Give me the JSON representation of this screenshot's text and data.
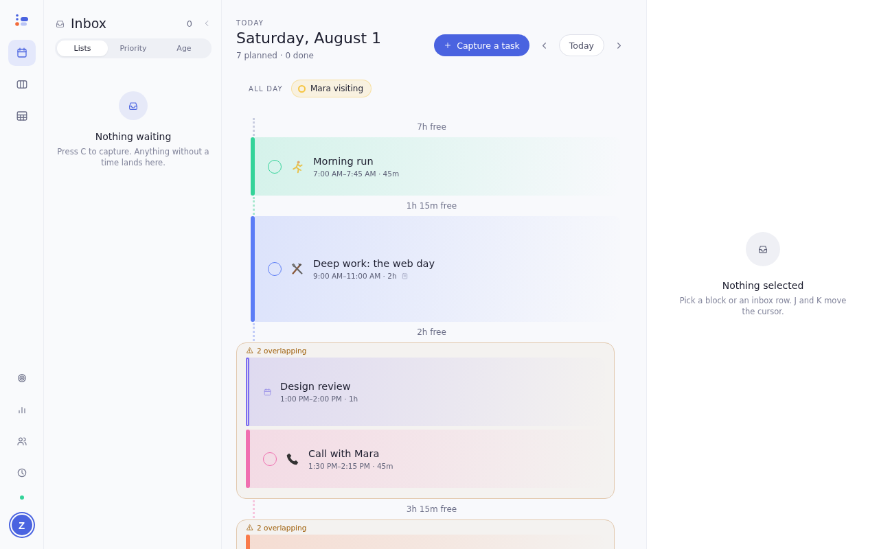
{
  "rail": {
    "top": [
      {
        "kind": "calendar",
        "selected": true
      },
      {
        "kind": "columns",
        "selected": false
      },
      {
        "kind": "table",
        "selected": false
      }
    ],
    "bottom": [
      {
        "kind": "target",
        "selected": false
      },
      {
        "kind": "chart",
        "selected": false
      },
      {
        "kind": "people",
        "selected": false
      },
      {
        "kind": "clock",
        "selected": false
      }
    ],
    "status": {
      "online": true
    },
    "avatar": "Z"
  },
  "inbox": {
    "title": "Inbox",
    "count": "0",
    "tabs": [
      {
        "label": "Lists",
        "selected": true
      },
      {
        "label": "Priority",
        "selected": false
      },
      {
        "label": "Age",
        "selected": false
      }
    ],
    "empty": {
      "title": "Nothing waiting",
      "text": "Press C to capture. Anything without a time lands here."
    }
  },
  "day": {
    "eyebrow": "TODAY",
    "title": "Saturday, August 1",
    "summary": "7 planned · 0 done",
    "capture": "Capture a task",
    "today": "Today",
    "allday": {
      "label": "ALL DAY",
      "events": [
        {
          "title": "Mara visiting",
          "color": "#f5c542"
        }
      ]
    },
    "timeline": [
      {
        "kind": "gap",
        "label": "7h free",
        "color": "#c9cde0"
      },
      {
        "kind": "task",
        "title": "Morning run",
        "meta": "7:00 AM–7:45 AM · 45m",
        "color": "#34d399",
        "done": false,
        "note": false
      },
      {
        "kind": "gap",
        "label": "1h 15m free",
        "color": "#a7e8cf"
      },
      {
        "kind": "task",
        "title": "Deep work: the web day",
        "meta": "9:00 AM–11:00 AM · 2h",
        "color": "#5b7cf6",
        "done": false,
        "note": true
      },
      {
        "kind": "gap",
        "label": "2h free",
        "color": "#c3cdf8"
      },
      {
        "kind": "overlap",
        "label": "2 overlapping",
        "items": [
          {
            "kind": "event",
            "title": "Design review",
            "meta": "1:00 PM–2:00 PM · 1h",
            "color": "#7c6cf0"
          },
          {
            "kind": "task",
            "title": "Call with Mara",
            "meta": "1:30 PM–2:15 PM · 45m",
            "color": "#f06fb0",
            "done": false,
            "note": false
          }
        ]
      },
      {
        "kind": "gap",
        "label": "3h 15m free",
        "color": "#f7c6de"
      },
      {
        "kind": "overlap",
        "label": "2 overlapping",
        "items": [
          {
            "kind": "task",
            "color": "#f97a4a"
          }
        ]
      }
    ]
  },
  "detail": {
    "title": "Nothing selected",
    "text": "Pick a block or an inbox row. J and K move the cursor."
  }
}
